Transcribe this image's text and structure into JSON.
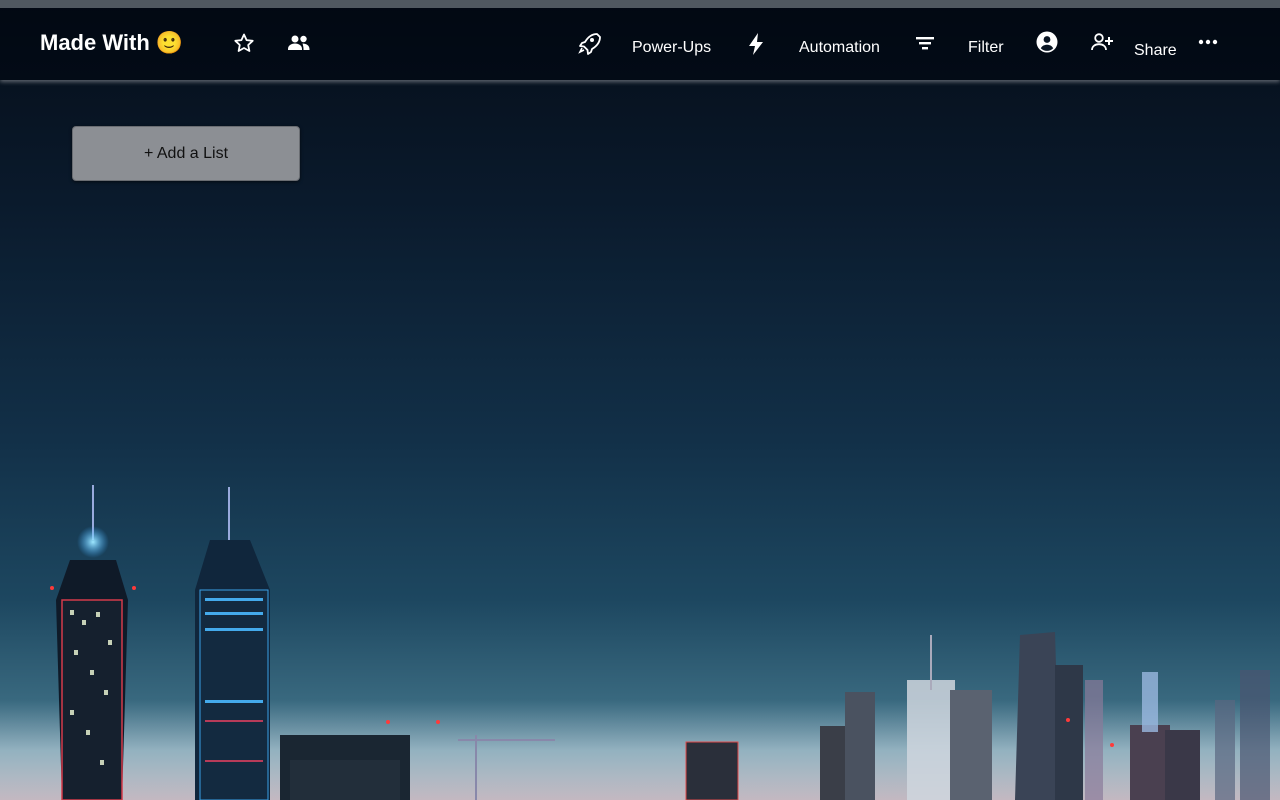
{
  "board": {
    "title": "Made With",
    "emoji": "🙂"
  },
  "header": {
    "power_ups_label": "Power-Ups",
    "automation_label": "Automation",
    "filter_label": "Filter",
    "share_label": "Share"
  },
  "icons": {
    "star": "star-icon",
    "members": "people-icon",
    "power_ups": "rocket-icon",
    "automation": "lightning-icon",
    "filter": "filter-icon",
    "profile": "account-circle-icon",
    "share": "person-add-icon",
    "more": "more-horizontal-icon"
  },
  "main": {
    "add_list_label": "+ Add a List"
  },
  "colors": {
    "text": "#ffffff",
    "add_list_bg": "#8c8f94"
  }
}
